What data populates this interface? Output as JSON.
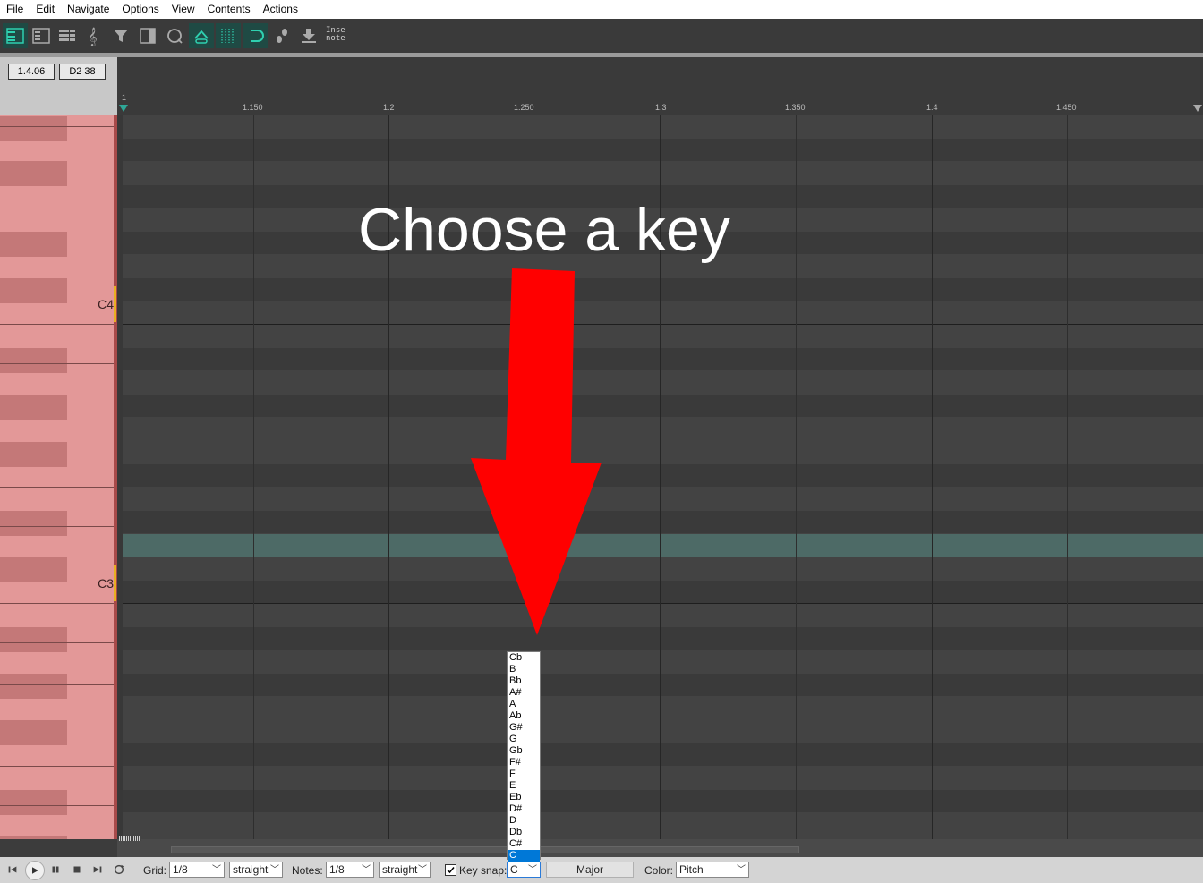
{
  "menu": [
    "File",
    "Edit",
    "Navigate",
    "Options",
    "View",
    "Contents",
    "Actions"
  ],
  "toolbar": {
    "icons": [
      "piano-roll-view-icon",
      "named-notes-view-icon",
      "event-list-view-icon",
      "notation-view-icon",
      "filter-icon",
      "media-item-lane-icon",
      "ccs-icon",
      "snap-to-grid-icon",
      "grid-lines-icon",
      "loop-icon",
      "step-input-icon",
      "insert-note-icon"
    ],
    "insert_note_line1": "Inse",
    "insert_note_line2": "note"
  },
  "info": {
    "position": "1.4.06",
    "pitch": "D2  38"
  },
  "ruler": {
    "labels": [
      "1",
      "1.150",
      "1.2",
      "1.250",
      "1.3",
      "1.350",
      "1.4",
      "1.450"
    ]
  },
  "piano": {
    "c4_label": "C4",
    "c3_label": "C3"
  },
  "overlay": {
    "title": "Choose a key",
    "arrow_color": "#ff0000"
  },
  "bottom": {
    "grid_label": "Grid:",
    "grid_value": "1/8",
    "grid_type": "straight",
    "notes_label": "Notes:",
    "notes_value": "1/8",
    "notes_type": "straight",
    "key_snap_label": "Key snap:",
    "key_snap_checked": true,
    "key_value": "C",
    "scale_value": "Major",
    "color_label": "Color:",
    "color_value": "Pitch"
  },
  "key_options": [
    "Cb",
    "B",
    "Bb",
    "A#",
    "A",
    "Ab",
    "G#",
    "G",
    "Gb",
    "F#",
    "F",
    "E",
    "Eb",
    "D#",
    "D",
    "Db",
    "C#",
    "C"
  ],
  "key_selected": "C",
  "colors": {
    "accent": "#0078d7",
    "piano": "#e39898",
    "highlight_row": "#4d6a66"
  }
}
